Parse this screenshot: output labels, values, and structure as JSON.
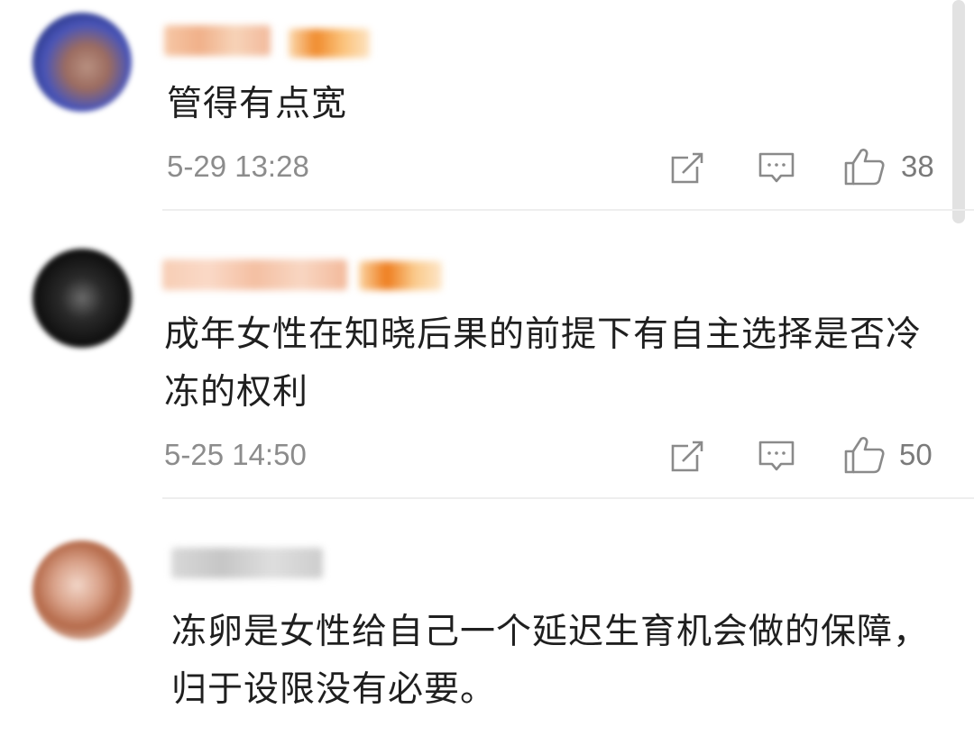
{
  "comments": [
    {
      "text": "管得有点宽",
      "date": "5-29 13:28",
      "likes": "38",
      "avatar_icon": "blurred-avatar",
      "actions": [
        "share-icon",
        "reply-icon",
        "thumbs-up-icon"
      ]
    },
    {
      "text": "成年女性在知晓后果的前提下有自主选择是否冷冻的权利",
      "date": "5-25 14:50",
      "likes": "50",
      "avatar_icon": "blurred-avatar",
      "actions": [
        "share-icon",
        "reply-icon",
        "thumbs-up-icon"
      ]
    },
    {
      "text": "冻卵是女性给自己一个延迟生育机会做的保障，归于设限没有必要。",
      "avatar_icon": "blurred-avatar"
    }
  ],
  "colors": {
    "text": "#1f1f1f",
    "meta": "#8c8c8c",
    "icon": "#8a8a8a",
    "divider": "#eeeeee"
  }
}
